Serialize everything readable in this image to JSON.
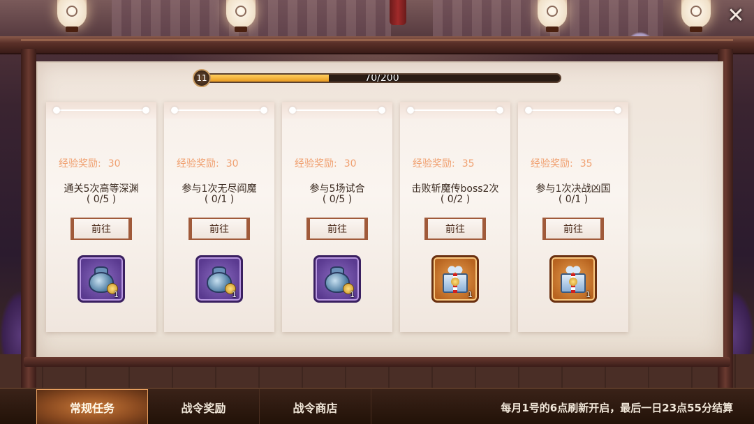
{
  "header": {
    "close_icon": "close-icon",
    "close_glyph": "✕"
  },
  "progress": {
    "level": "11",
    "text": "70/200",
    "current": 70,
    "max": 200
  },
  "tasks": [
    {
      "exp_label": "经验奖励:",
      "exp_value": "30",
      "title": "通关5次高等深渊",
      "count": "( 0/5 )",
      "go_label": "前往",
      "reward_type": "bag",
      "reward_qty": "1"
    },
    {
      "exp_label": "经验奖励:",
      "exp_value": "30",
      "title": "参与1次无尽阎魔",
      "count": "( 0/1 )",
      "go_label": "前往",
      "reward_type": "bag",
      "reward_qty": "1"
    },
    {
      "exp_label": "经验奖励:",
      "exp_value": "30",
      "title": "参与5场试合",
      "count": "( 0/5 )",
      "go_label": "前往",
      "reward_type": "bag",
      "reward_qty": "1"
    },
    {
      "exp_label": "经验奖励:",
      "exp_value": "35",
      "title": "击败斩魔传boss2次",
      "count": "( 0/2 )",
      "go_label": "前往",
      "reward_type": "gift",
      "reward_qty": "1"
    },
    {
      "exp_label": "经验奖励:",
      "exp_value": "35",
      "title": "参与1次决战凶国",
      "count": "( 0/1 )",
      "go_label": "前往",
      "reward_type": "gift",
      "reward_qty": "1"
    }
  ],
  "tabs": [
    {
      "label": "常规任务",
      "active": true
    },
    {
      "label": "战令奖励",
      "active": false
    },
    {
      "label": "战令商店",
      "active": false
    }
  ],
  "notice": "每月1号的6点刷新开启，最后一日23点55分结算",
  "colors": {
    "exp_text": "#f0a070",
    "progress_fill": "#e89a20",
    "tab_active": "#c87838"
  }
}
